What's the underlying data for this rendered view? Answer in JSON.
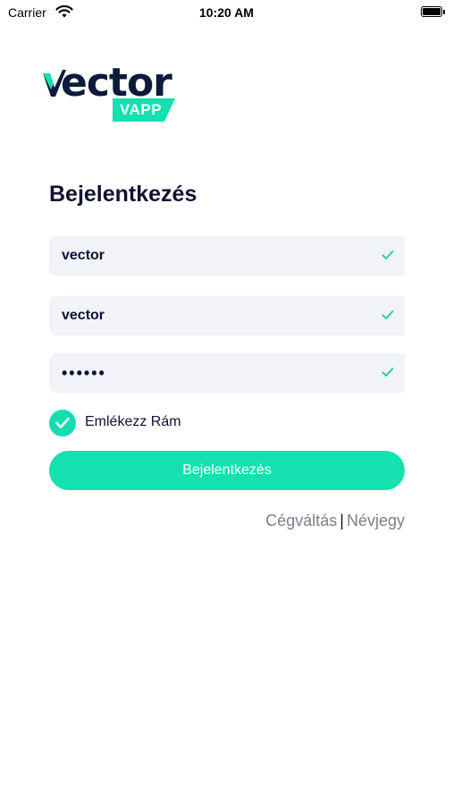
{
  "status_bar": {
    "carrier": "Carrier",
    "time": "10:20 AM"
  },
  "logo": {
    "word": "ector",
    "badge": "VAPP"
  },
  "title": "Bejelentkezés",
  "fields": [
    {
      "value": "vector",
      "valid": true
    },
    {
      "value": "vector",
      "valid": true
    },
    {
      "value": "••••••",
      "valid": true
    }
  ],
  "remember": {
    "label": "Emlékezz Rám",
    "checked": true
  },
  "login_button": {
    "label": "Bejelentkezés"
  },
  "links": {
    "company_switch": "Cégváltás",
    "separator": "|",
    "about": "Névjegy"
  },
  "colors": {
    "accent": "#14e0b0",
    "field_bg": "#f1f3f8",
    "text": "#111133",
    "link": "#7b7f8c"
  }
}
